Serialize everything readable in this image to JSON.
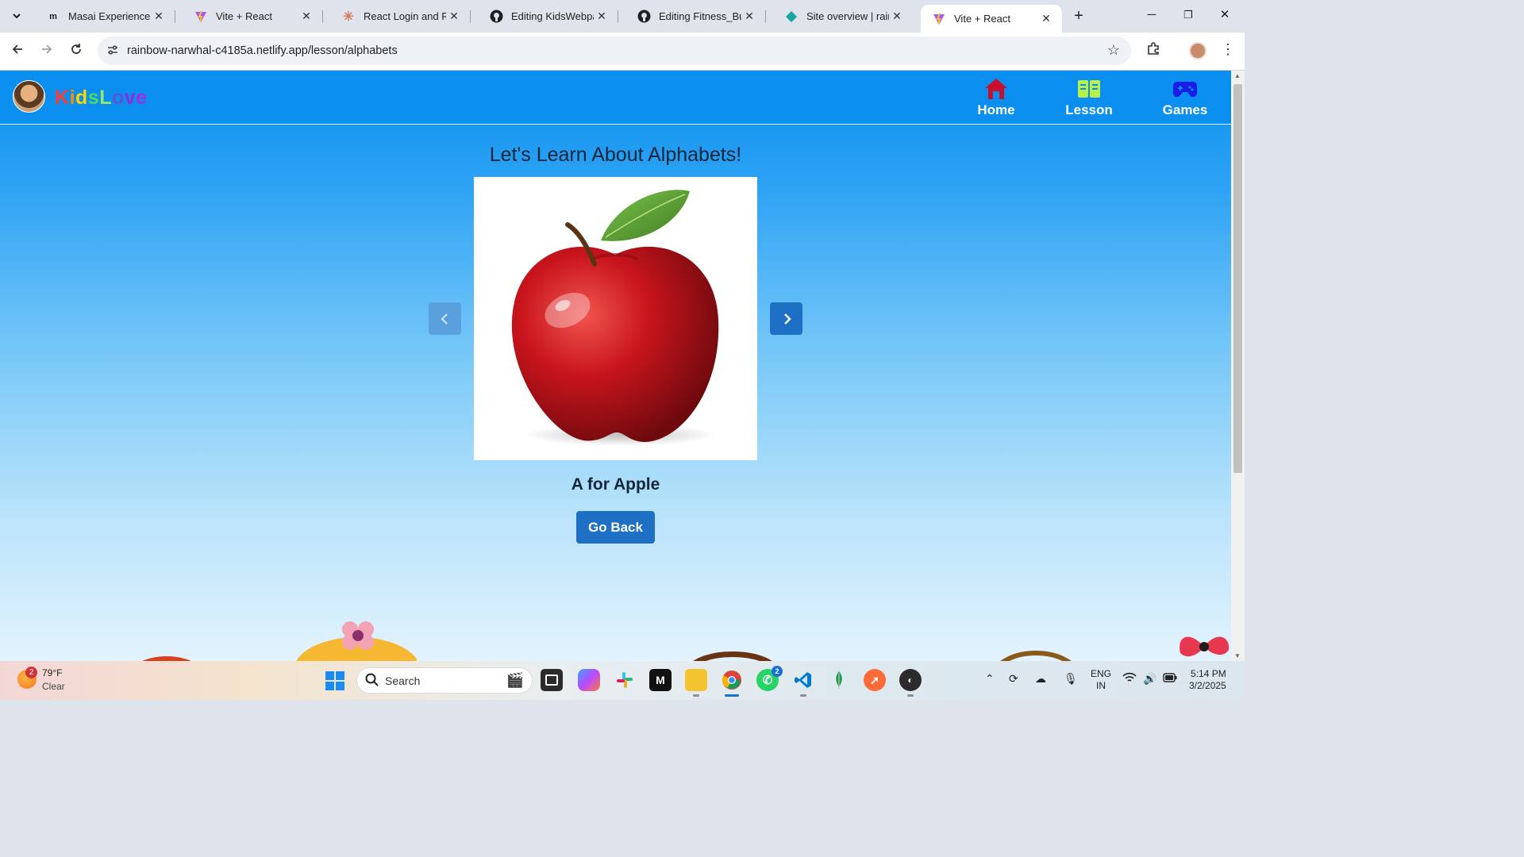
{
  "browser": {
    "tabs": [
      {
        "title": "Masai Experience",
        "favicon": "masai-icon"
      },
      {
        "title": "Vite + React",
        "favicon": "vite-icon"
      },
      {
        "title": "React Login and Regi",
        "favicon": "claude-icon"
      },
      {
        "title": "Editing KidsWebpage",
        "favicon": "github-icon"
      },
      {
        "title": "Editing Fitness_Budd",
        "favicon": "github-icon"
      },
      {
        "title": "Site overview | rainbo",
        "favicon": "netlify-icon"
      },
      {
        "title": "Vite + React",
        "favicon": "vite-icon",
        "active": true
      }
    ],
    "url": "rainbow-narwhal-c4185a.netlify.app/lesson/alphabets"
  },
  "site": {
    "logo_letters": [
      "K",
      "i",
      "d",
      "s",
      "L",
      "o",
      "v",
      "e"
    ],
    "logo_colors": [
      "#ff3b30",
      "#ff8c00",
      "#ffd400",
      "#4cd964",
      "#9be564",
      "#5856d6",
      "#8a2be2",
      "#a02ee0"
    ],
    "nav": [
      {
        "label": "Home",
        "icon": "home-icon",
        "color": "#c8102e"
      },
      {
        "label": "Lesson",
        "icon": "book-icon",
        "color": "#b8f04a"
      },
      {
        "label": "Games",
        "icon": "gamepad-icon",
        "color": "#1c1ce8"
      }
    ]
  },
  "lesson": {
    "title": "Let's Learn About Alphabets!",
    "caption": "A for Apple",
    "go_back": "Go Back",
    "image": "apple-image"
  },
  "taskbar": {
    "weather_temp": "79°F",
    "weather_cond": "Clear",
    "weather_badge": "2",
    "search_label": "Search",
    "whatsapp_badge": "2",
    "lang_top": "ENG",
    "lang_bottom": "IN",
    "time": "5:14 PM",
    "date": "3/2/2025"
  }
}
